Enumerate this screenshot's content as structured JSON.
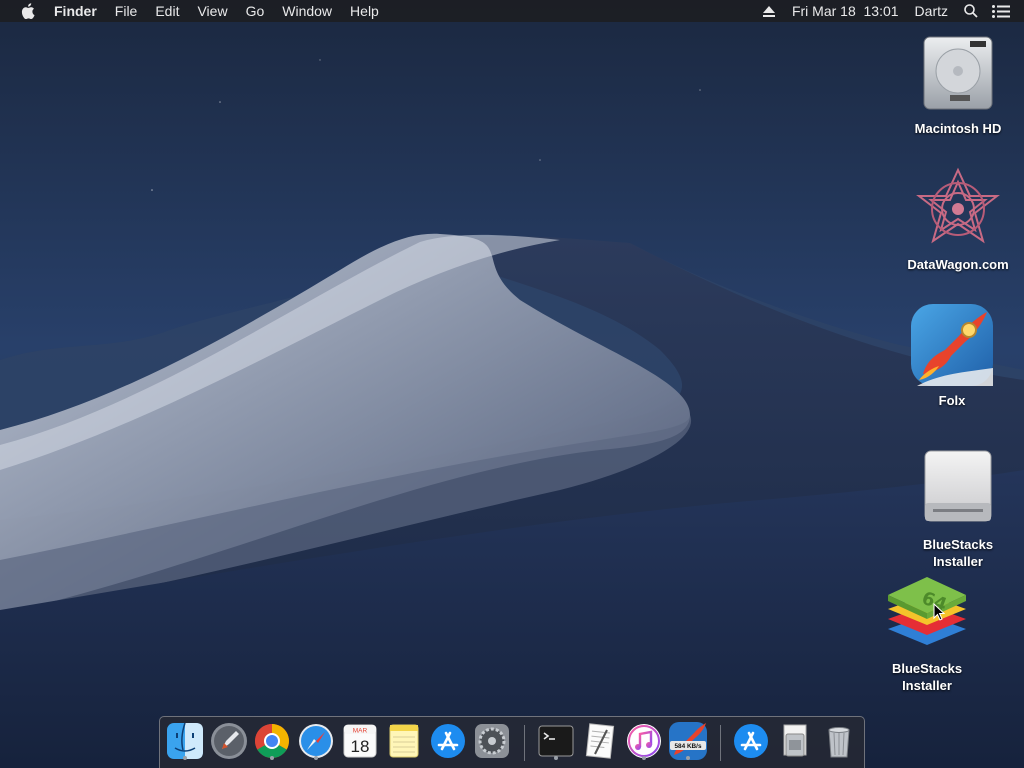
{
  "menubar": {
    "apple_icon": "apple-icon",
    "app_name": "Finder",
    "menus": [
      "File",
      "Edit",
      "View",
      "Go",
      "Window",
      "Help"
    ],
    "eject_icon": "eject-icon",
    "clock": "Fri Mar 18  13:01",
    "user": "Dartz",
    "search_icon": "spotlight-search-icon",
    "notification_icon": "notification-center-icon"
  },
  "desktop_icons": [
    {
      "label": "Macintosh HD",
      "icon": "hard-drive-icon"
    },
    {
      "label": "DataWagon.com",
      "icon": "datawagon-icon"
    },
    {
      "label": "Folx",
      "icon": "folx-rocket-icon"
    },
    {
      "label": "BlueStacks\nInstaller",
      "icon": "external-disk-icon"
    },
    {
      "label": "BlueStacks\nInstaller",
      "icon": "bluestacks-icon"
    }
  ],
  "dock": {
    "apps": [
      {
        "name": "Finder",
        "icon": "finder-icon",
        "running": true
      },
      {
        "name": "Launchpad",
        "icon": "launchpad-icon",
        "running": false
      },
      {
        "name": "Google Chrome",
        "icon": "chrome-icon",
        "running": true
      },
      {
        "name": "Safari",
        "icon": "safari-icon",
        "running": true
      },
      {
        "name": "Calendar",
        "icon": "calendar-icon",
        "running": false,
        "month": "MAR",
        "day": "18"
      },
      {
        "name": "Notes",
        "icon": "notes-icon",
        "running": false
      },
      {
        "name": "App Store",
        "icon": "app-store-icon",
        "running": false
      },
      {
        "name": "System Preferences",
        "icon": "system-preferences-icon",
        "running": false
      },
      {
        "name": "Terminal",
        "icon": "terminal-icon",
        "running": true
      },
      {
        "name": "TextEdit",
        "icon": "textedit-icon",
        "running": false
      },
      {
        "name": "iTunes",
        "icon": "itunes-icon",
        "running": true
      },
      {
        "name": "Folx",
        "icon": "folx-icon",
        "running": true,
        "badge": "584 KB/s"
      },
      {
        "name": "App Store Downloads",
        "icon": "app-store-folder-icon",
        "running": false
      },
      {
        "name": "Documents",
        "icon": "document-stack-icon",
        "running": false
      },
      {
        "name": "Trash",
        "icon": "trash-icon",
        "running": false
      }
    ]
  },
  "colors": {
    "menubar_bg": "#1c1e24",
    "wallpaper_sky": "#1f3154",
    "dune_light": "#b9c3d3"
  }
}
